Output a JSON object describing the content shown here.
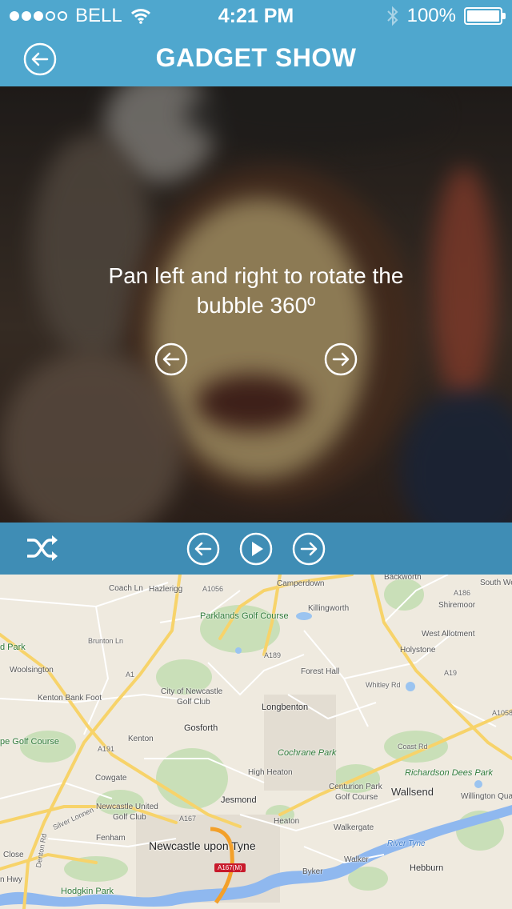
{
  "status": {
    "carrier": "BELL",
    "time": "4:21 PM",
    "battery": "100%",
    "signal_bars": 3,
    "signal_total": 5,
    "icons": [
      "wifi-icon",
      "bluetooth-icon",
      "battery-icon"
    ]
  },
  "nav": {
    "title": "GADGET SHOW",
    "back_icon": "back-arrow-icon"
  },
  "photo": {
    "instruction": "Pan left and right to rotate the bubble 360º"
  },
  "toolbar": {
    "icons": [
      "shuffle-icon",
      "previous-icon",
      "play-icon",
      "next-icon"
    ]
  },
  "map": {
    "labels": {
      "backworth": "Backworth",
      "south_we": "South We",
      "coach_ln": "Coach Ln",
      "hazlerigg": "Hazlerigg",
      "a1056": "A1056",
      "camperdown": "Camperdown",
      "a186": "A186",
      "shiremoor": "Shiremoor",
      "parklands": "Parklands Golf Course",
      "killingworth": "Killingworth",
      "d_park": "d Park",
      "brunton_ln": "Brunton Ln",
      "west_allotment": "West Allotment",
      "woolsington": "Woolsington",
      "a189": "A189",
      "holystone": "Holystone",
      "forest_hall": "Forest Hall",
      "whitley_rd": "Whitley Rd",
      "a19": "A19",
      "a1": "A1",
      "city_golf": "City of Newcastle",
      "golf_club": "Golf Club",
      "kenton_bank_foot": "Kenton Bank Foot",
      "longbenton": "Longbenton",
      "a1058": "A1058",
      "gosforth": "Gosforth",
      "pe_golf": "pe Golf Course",
      "kenton": "Kenton",
      "a191": "A191",
      "coast_rd": "Coast Rd",
      "cochrane_park": "Cochrane Park",
      "high_heaton": "High Heaton",
      "richardson": "Richardson Dees Park",
      "cowgate": "Cowgate",
      "centurion": "Centurion Park",
      "centurion_golf": "Golf Course",
      "wallsend": "Wallsend",
      "willington_qua": "Willington Qua",
      "newcastle_united": "Newcastle United",
      "nu_golf": "Golf Club",
      "jesmond": "Jesmond",
      "silver_lonnen": "Silver Lonnen",
      "a167": "A167",
      "heaton": "Heaton",
      "walkergate": "Walkergate",
      "fenham": "Fenham",
      "river_tyne": "River Tyne",
      "newcastle": "Newcastle upon Tyne",
      "close": "Close",
      "denton_rd": "Denton Rd",
      "a167m": "A167(M)",
      "walker": "Walker",
      "byker": "Byker",
      "hebburn": "Hebburn",
      "n_hwy": "n Hwy",
      "hodgkin": "Hodgkin Park"
    }
  }
}
